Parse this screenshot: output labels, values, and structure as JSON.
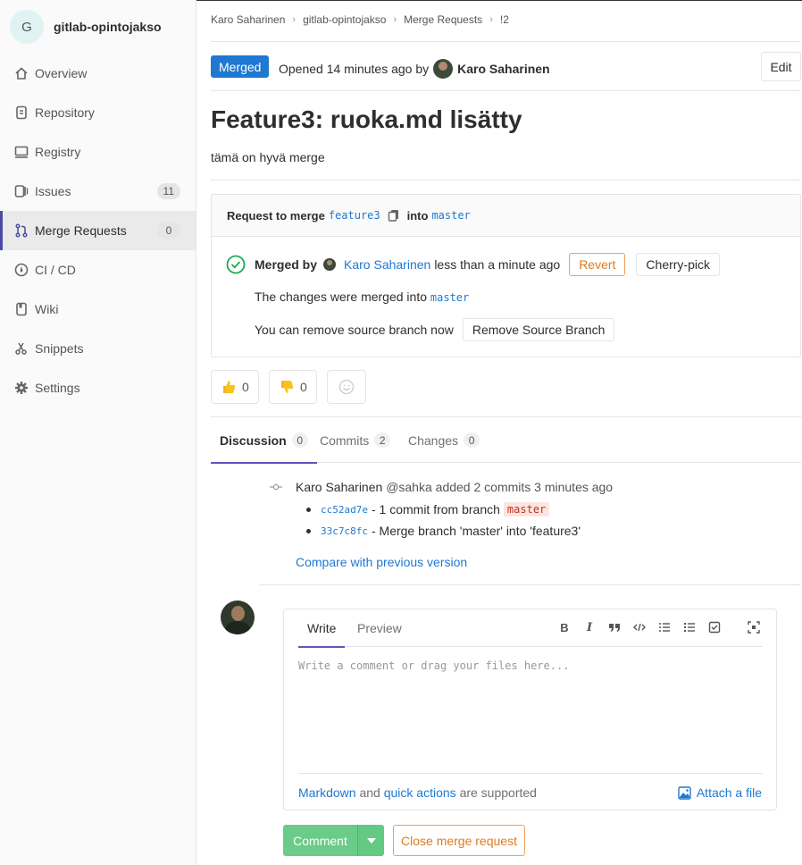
{
  "project": {
    "avatar_letter": "G",
    "name": "gitlab-opintojakso"
  },
  "sidebar": {
    "items": [
      {
        "label": "Overview",
        "icon": "home-icon"
      },
      {
        "label": "Repository",
        "icon": "doc-icon"
      },
      {
        "label": "Registry",
        "icon": "container-icon"
      },
      {
        "label": "Issues",
        "icon": "issues-icon",
        "count": "11"
      },
      {
        "label": "Merge Requests",
        "icon": "merge-request-icon",
        "count": "0",
        "active": true
      },
      {
        "label": "CI / CD",
        "icon": "rocket-icon"
      },
      {
        "label": "Wiki",
        "icon": "book-icon"
      },
      {
        "label": "Snippets",
        "icon": "scissors-icon"
      },
      {
        "label": "Settings",
        "icon": "gear-icon"
      }
    ]
  },
  "breadcrumb": [
    "Karo Saharinen",
    "gitlab-opintojakso",
    "Merge Requests",
    "!2"
  ],
  "header": {
    "status": "Merged",
    "opened_text": "Opened 14 minutes ago by",
    "author": "Karo Saharinen",
    "edit_label": "Edit"
  },
  "mr": {
    "title": "Feature3: ruoka.md lisätty",
    "description": "tämä on hyvä merge"
  },
  "widget": {
    "request_label": "Request to merge",
    "source_branch": "feature3",
    "into_label": "into",
    "target_branch": "master",
    "merged_by_label": "Merged by",
    "merged_by": "Karo Saharinen",
    "merged_when": "less than a minute ago",
    "revert_label": "Revert",
    "cherry_pick_label": "Cherry-pick",
    "changes_merged_text": "The changes were merged into",
    "changes_target": "master",
    "remove_text": "You can remove source branch now",
    "remove_button": "Remove Source Branch"
  },
  "awards": {
    "thumbsup": "0",
    "thumbsdown": "0"
  },
  "tabs": [
    {
      "label": "Discussion",
      "count": "0",
      "active": true
    },
    {
      "label": "Commits",
      "count": "2"
    },
    {
      "label": "Changes",
      "count": "0"
    }
  ],
  "note": {
    "author": "Karo Saharinen",
    "username": "@sahka",
    "action": "added 2 commits 3 minutes ago",
    "commits": [
      {
        "sha": "cc52ad7e",
        "text": "- 1 commit from branch",
        "branch": "master"
      },
      {
        "sha": "33c7c8fc",
        "text": "- Merge branch 'master' into 'feature3'"
      }
    ],
    "compare_link": "Compare with previous version"
  },
  "editor": {
    "tab_write": "Write",
    "tab_preview": "Preview",
    "placeholder": "Write a comment or drag your files here...",
    "markdown_link": "Markdown",
    "and_text": "and",
    "quick_actions_link": "quick actions",
    "supported_text": "are supported",
    "attach_label": "Attach a file"
  },
  "actions": {
    "comment_label": "Comment",
    "close_label": "Close merge request"
  },
  "colors": {
    "accent": "#1f78d1",
    "merged_badge": "#1f78d1",
    "success": "#1aaa55",
    "warning": "#e07a1f",
    "tab_underline": "#6b4fbb"
  }
}
